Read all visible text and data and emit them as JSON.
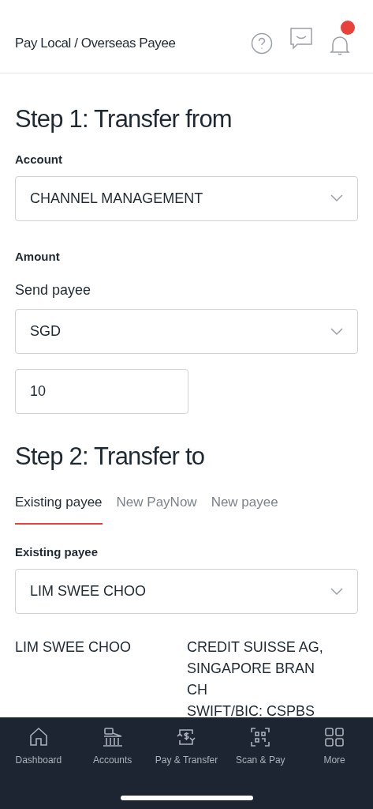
{
  "header": {
    "title": "Pay Local / Overseas Payee",
    "notification_badge": true
  },
  "step1": {
    "title": "Step 1: Transfer from",
    "account_label": "Account",
    "account_value": "CHANNEL MANAGEMENT",
    "amount_label": "Amount",
    "send_label": "Send payee",
    "currency_value": "SGD",
    "amount_value": "10"
  },
  "step2": {
    "title": "Step 2: Transfer to",
    "tabs": [
      {
        "label": "Existing payee",
        "selected": true
      },
      {
        "label": "New PayNow",
        "selected": false
      },
      {
        "label": "New payee",
        "selected": false
      }
    ],
    "payee_label": "Existing payee",
    "payee_value": "LIM SWEE CHOO",
    "payee_name": "LIM SWEE CHOO",
    "bank_lines": [
      "CREDIT SUISSE AG,",
      "SINGAPORE BRAN",
      "CH",
      "SWIFT/BIC: CSPBS"
    ]
  },
  "bottom_nav": [
    {
      "kind": "home",
      "label": "Dashboard",
      "selected": false
    },
    {
      "kind": "bank",
      "label": "Accounts",
      "selected": false
    },
    {
      "kind": "transfer",
      "label": "Pay & Transfer",
      "selected": false
    },
    {
      "kind": "scan",
      "label": "Scan & Pay",
      "selected": false
    },
    {
      "kind": "grid",
      "label": "More",
      "selected": false
    }
  ]
}
